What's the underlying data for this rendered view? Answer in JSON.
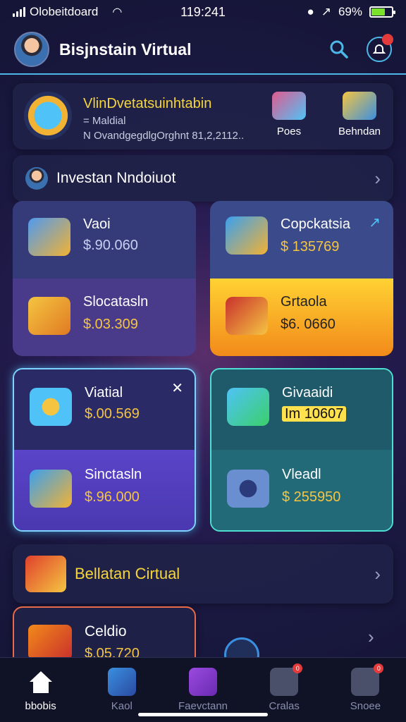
{
  "status_bar": {
    "carrier": "Olobeitdoard",
    "time": "119:241",
    "battery": "69%",
    "battery_level": 0.69
  },
  "header": {
    "title": "Bisjnstain Virtual"
  },
  "promo": {
    "title": "VlinDvetatsuinhtabin",
    "subtitle": "= Maldial",
    "meta": "N OvandgegdlgOrghnt 81,2,2112..",
    "actions": [
      {
        "label": "Poes"
      },
      {
        "label": "Behndan"
      }
    ]
  },
  "section_invest": {
    "title": "Investan Nndoiuot"
  },
  "tiles": [
    {
      "top": {
        "label": "Vaoi",
        "value": "$.90.060"
      },
      "bottom": {
        "label": "Slocatasln",
        "value": "$.03.309"
      }
    },
    {
      "top": {
        "label": "Copckatsia",
        "value": "$ 135769"
      },
      "bottom": {
        "label": "Grtaola",
        "value": "$6. 0660"
      }
    },
    {
      "top": {
        "label": "Viatial",
        "value": "$.00.569"
      },
      "bottom": {
        "label": "Sinctasln",
        "value": "$.96.000"
      }
    },
    {
      "top": {
        "label": "Givaaidi",
        "value": "Im 10607"
      },
      "bottom": {
        "label": "Vleadl",
        "value": "$ 255950"
      }
    }
  ],
  "section_virtual": {
    "title": "Bellatan Cirtual"
  },
  "peek_card": {
    "label": "Celdio",
    "value": "$.05.720"
  },
  "tabbar": [
    {
      "label": "bbobis"
    },
    {
      "label": "Kaol"
    },
    {
      "label": "Faevctann"
    },
    {
      "label": "Cralas",
      "badge": "0"
    },
    {
      "label": "Snoee",
      "badge": "0"
    }
  ]
}
